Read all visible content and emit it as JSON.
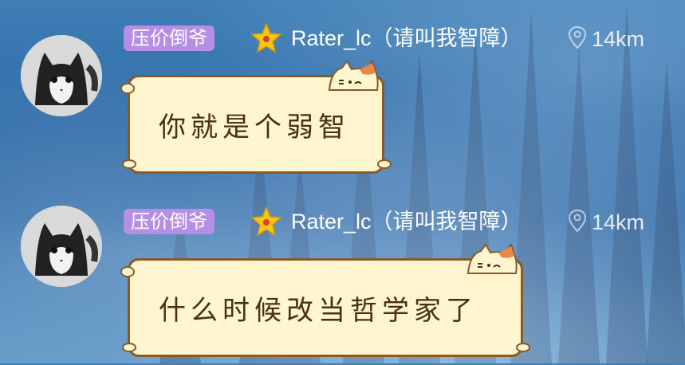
{
  "messages": [
    {
      "tag": "压价倒爷",
      "username": "Rater_lc（请叫我智障）",
      "distance": "14km",
      "text": "你就是个弱智"
    },
    {
      "tag": "压价倒爷",
      "username": "Rater_lc（请叫我智障）",
      "distance": "14km",
      "text": "什么时候改当哲学家了"
    }
  ],
  "colors": {
    "tag_bg": "#b68ee6",
    "bubble_bg": "#fff5cf",
    "bubble_border": "#8a5a26",
    "text": "#4a2f14",
    "star": "#f5c518"
  },
  "icons": [
    "avatar-cat",
    "star-icon",
    "location-pin-icon",
    "cat-ears-icon"
  ]
}
